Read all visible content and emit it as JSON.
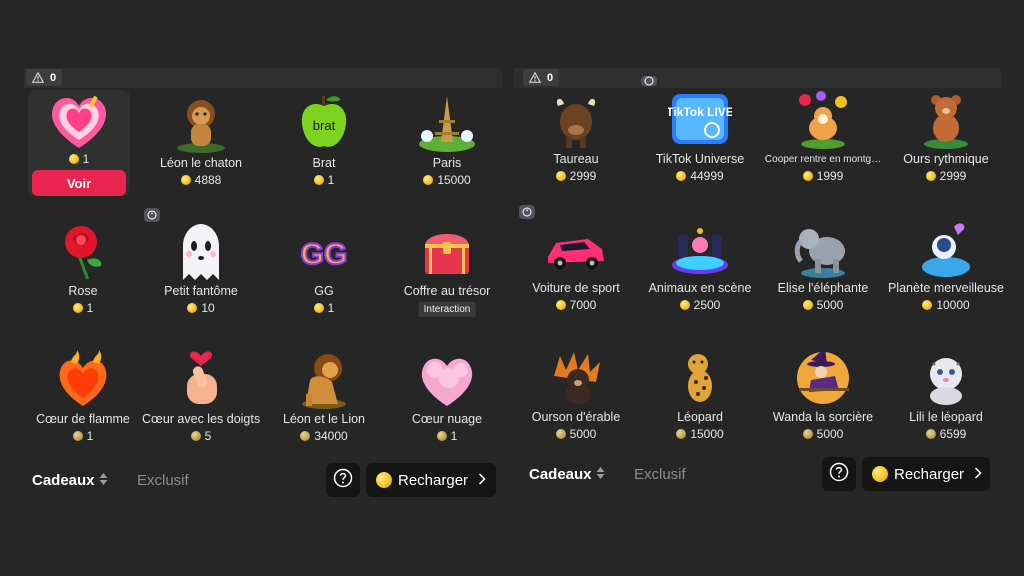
{
  "colors": {
    "background": "#262626",
    "accent": "#e8244f",
    "coin": "#f3c11a"
  },
  "panels": [
    {
      "warning_count": "0",
      "selected": {
        "name": "",
        "price": "1",
        "action_label": "Voir"
      },
      "gifts": [
        {
          "name": "Léon le chaton",
          "price": "4888",
          "icon": "lion-cub-icon"
        },
        {
          "name": "Brat",
          "price": "1",
          "icon": "green-apple-icon"
        },
        {
          "name": "Paris",
          "price": "15000",
          "icon": "eiffel-tower-icon"
        },
        {
          "name": "Rose",
          "price": "1",
          "icon": "rose-icon"
        },
        {
          "name": "Petit fantôme",
          "price": "10",
          "icon": "ghost-icon"
        },
        {
          "name": "GG",
          "price": "1",
          "icon": "gg-letters-icon"
        },
        {
          "name": "Coffre au trésor",
          "price": "",
          "icon": "treasure-chest-icon",
          "tag": "Interaction"
        },
        {
          "name": "Cœur de flamme",
          "price": "1",
          "icon": "flame-heart-icon"
        },
        {
          "name": "Cœur avec les doigts",
          "price": "5",
          "icon": "finger-heart-icon"
        },
        {
          "name": "Léon et le Lion",
          "price": "34000",
          "icon": "lion-icon"
        },
        {
          "name": "Cœur nuage",
          "price": "1",
          "icon": "cloud-heart-icon"
        }
      ],
      "footer": {
        "tab_gifts": "Cadeaux",
        "tab_exclusive": "Exclusif",
        "recharge": "Recharger"
      }
    },
    {
      "warning_count": "0",
      "gifts": [
        {
          "name": "Taureau",
          "price": "2999",
          "icon": "bull-icon"
        },
        {
          "name": "TikTok Universe",
          "price": "44999",
          "icon": "tiktok-live-icon",
          "logo_text": "TikTok LIVE"
        },
        {
          "name": "Cooper rentre en montg…",
          "price": "1999",
          "icon": "corgi-balloons-icon"
        },
        {
          "name": "Ours rythmique",
          "price": "2999",
          "icon": "teddy-bear-icon"
        },
        {
          "name": "Voiture de sport",
          "price": "7000",
          "icon": "sports-car-icon"
        },
        {
          "name": "Animaux en scène",
          "price": "2500",
          "icon": "animal-stage-icon"
        },
        {
          "name": "Elise l'éléphante",
          "price": "5000",
          "icon": "elephant-icon"
        },
        {
          "name": "Planète merveilleuse",
          "price": "10000",
          "icon": "planet-astronaut-icon"
        },
        {
          "name": "Ourson d'érable",
          "price": "5000",
          "icon": "maple-bear-icon"
        },
        {
          "name": "Léopard",
          "price": "15000",
          "icon": "leopard-icon"
        },
        {
          "name": "Wanda la sorcière",
          "price": "5000",
          "icon": "witch-icon"
        },
        {
          "name": "Lili le léopard",
          "price": "6599",
          "icon": "snow-leopard-icon"
        }
      ],
      "footer": {
        "tab_gifts": "Cadeaux",
        "tab_exclusive": "Exclusif",
        "recharge": "Recharger"
      }
    }
  ]
}
